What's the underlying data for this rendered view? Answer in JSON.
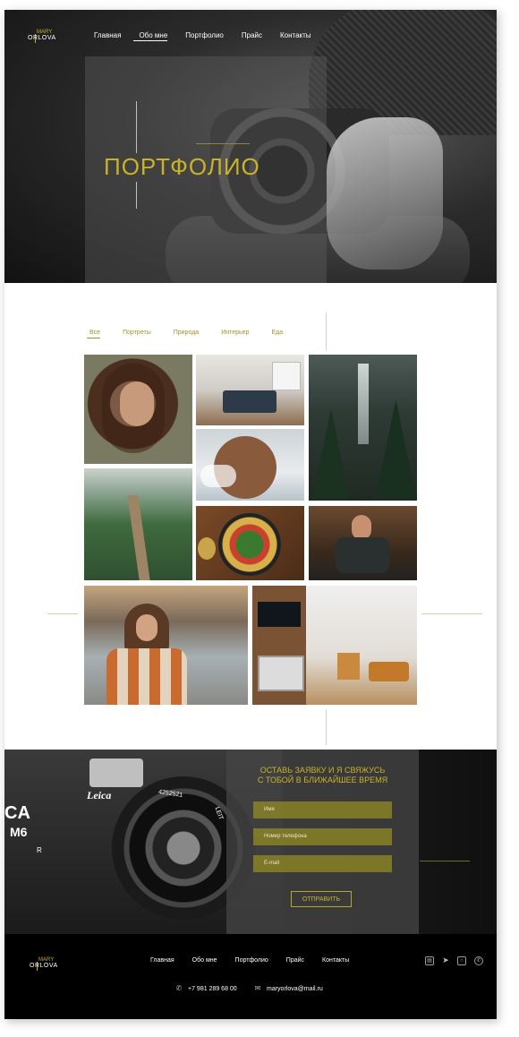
{
  "logo": {
    "line1": "MARY",
    "line2": "ORLOVA"
  },
  "nav": [
    "Главная",
    "Обо мне",
    "Портфолио",
    "Прайс",
    "Контакты"
  ],
  "hero": {
    "title": "ПОРТФОЛИО"
  },
  "filters": [
    "Все",
    "Портреты",
    "Природа",
    "Интерьер",
    "Еда"
  ],
  "contact": {
    "title_line1": "ОСТАВЬ ЗАЯВКУ И Я СВЯЖУСЬ",
    "title_line2": "С ТОБОЙ В БЛИЖАЙШЕЕ ВРЕМЯ",
    "name_placeholder": "Имя",
    "phone_placeholder": "Номер телефона",
    "email_placeholder": "E-mail",
    "submit": "ОТПРАВИТЬ",
    "camera_brand": "Leica",
    "camera_model_1": "CA",
    "camera_model_2": "M6",
    "camera_r": "R",
    "lens_number": "4252521",
    "lens_brand": "LEIT"
  },
  "footer": {
    "nav": [
      "Главная",
      "Обо мне",
      "Портфолио",
      "Прайс",
      "Контакты"
    ],
    "phone": "+7 981 289 68 00",
    "email": "maryorlova@mail.ru",
    "social_icons": [
      "vk-icon",
      "telegram-icon",
      "instagram-icon",
      "whatsapp-icon"
    ]
  },
  "colors": {
    "accent": "#c9b22a",
    "dark": "#000000"
  }
}
